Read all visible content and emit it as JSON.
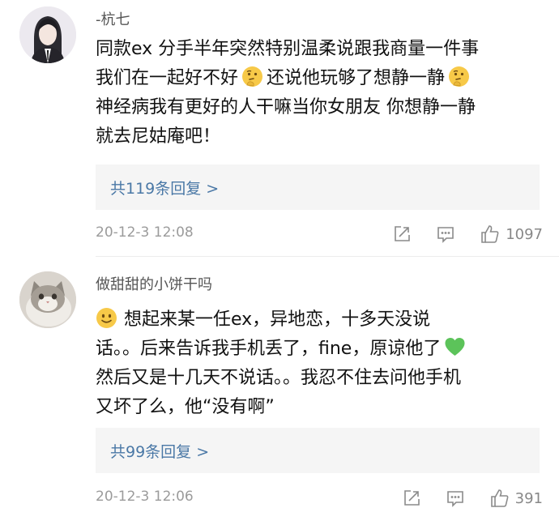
{
  "comments": [
    {
      "username": "-杭七",
      "lines": [
        "同款ex 分手半年突然特别温柔说跟我商量一件事",
        "我们在一起好不好",
        "还说他玩够了想静一静",
        "神经病我有更好的人干嘛当你女朋友 你想静一静",
        "就去尼姑庵吧！"
      ],
      "replies_label": "共119条回复 >",
      "timestamp": "20-12-3 12:08",
      "likes": "1097"
    },
    {
      "username": "做甜甜的小饼干吗",
      "lines": [
        "想起来某一任ex，异地恋，十多天没说",
        "话。。后来告诉我手机丢了，fine，原谅他了",
        "然后又是十几天不说话。。我忍不住去问他手机",
        "又坏了么，他“没有啊”"
      ],
      "replies_label": "共99条回复 >",
      "timestamp": "20-12-3 12:06",
      "likes": "391"
    }
  ],
  "icons": {
    "share": "share-icon",
    "comment": "comment-icon",
    "like": "thumbs-up-icon",
    "thinking": "thinking-face-emoji",
    "smile": "smiling-face-emoji",
    "heart": "green-heart-emoji"
  },
  "colors": {
    "link": "#4a78a6",
    "meta": "#9b9b9b",
    "reply_box": "#f5f5f5",
    "heart": "#5cc35a",
    "emoji": "#f7c948"
  }
}
